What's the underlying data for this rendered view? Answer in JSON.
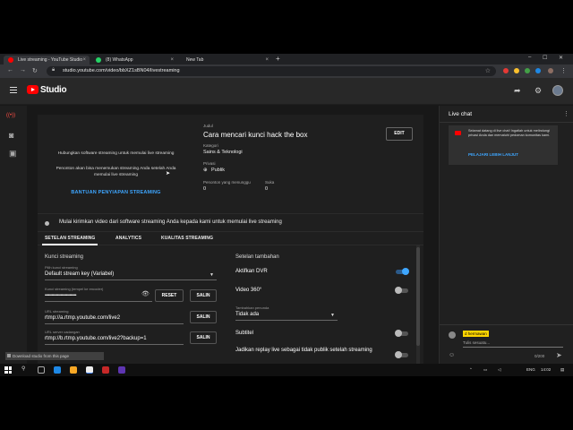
{
  "browser": {
    "tabs": [
      {
        "label": "Live streaming - YouTube Studio",
        "close": "×",
        "color": "#ff0000"
      },
      {
        "label": "(8) WhatsApp",
        "close": "×",
        "color": "#25d366"
      },
      {
        "label": "New Tab",
        "close": "×",
        "color": "#888888"
      }
    ],
    "new_tab": "+",
    "window_controls": [
      "–",
      "☐",
      "✕"
    ],
    "url": "studio.youtube.com/video/bbXZ1sBN04/livestreaming",
    "nav": [
      "←",
      "→",
      "↻"
    ]
  },
  "header": {
    "logo_text": "Studio",
    "icons": [
      "share-icon",
      "gear-icon",
      "avatar"
    ]
  },
  "rail": {
    "icons": [
      {
        "name": "live-icon",
        "glyph": "((•))",
        "active": true
      },
      {
        "name": "camera-icon",
        "glyph": "◙",
        "active": false
      },
      {
        "name": "calendar-icon",
        "glyph": "▣",
        "active": false
      }
    ]
  },
  "preview": {
    "line1": "Hubungkan software streaming untuk memulai live streaming",
    "line2": "Penonton akan bisa menemukan streaming Anda setelah Anda memulai live streaming",
    "help_link": "BANTUAN PENYIAPAN STREAMING"
  },
  "details": {
    "title_label": "Judul",
    "title": "Cara mencari kunci hack the box",
    "edit": "EDIT",
    "category_label": "Kategori",
    "category": "Sains & Teknologi",
    "privacy_label": "Privasi",
    "privacy": "Publik",
    "viewers_label": "Penonton yang menunggu",
    "viewers": "0",
    "likes_label": "Suka",
    "likes": "0"
  },
  "status": {
    "message": "Mulai kirimkan video dari software streaming Anda kepada kami untuk memulai live streaming"
  },
  "settings_tabs": [
    {
      "label": "SETELAN STREAMING",
      "active": true
    },
    {
      "label": "ANALYTICS",
      "active": false
    },
    {
      "label": "KUALITAS STREAMING",
      "active": false
    }
  ],
  "stream_key": {
    "section": "Kunci streaming",
    "select_label": "Pilih kunci streaming",
    "select_value": "Default stream key (Variabel)",
    "key_label": "Kunci streaming (tempel ke encoder)",
    "key_value": "••••••••••••••••••••••••••••",
    "reset": "RESET",
    "copy": "SALIN",
    "url_label": "URL streaming",
    "url_value": "rtmp://a.rtmp.youtube.com/live2",
    "backup_label": "URL server cadangan",
    "backup_value": "rtmp://b.rtmp.youtube.com/live2?backup=1"
  },
  "additional": {
    "section": "Setelan tambahan",
    "dvr": "Aktifkan DVR",
    "dvr_on": true,
    "v360": "Video 360°",
    "v360_on": false,
    "latency_label": "Tambahkan penunda",
    "latency_value": "Tidak ada",
    "subtitle": "Subtitel",
    "subtitle_on": false,
    "replay": "Jadikan replay live sebagai tidak publik setelah streaming"
  },
  "toast": "Download studio from this page",
  "chat": {
    "title": "Live chat",
    "welcome": "Selamat datang di live chat! Ingatlah untuk melindungi privasi Anda dan mematuhi pedoman komunitas kami.",
    "learn_more": "PELAJARI LEBIH LANJUT",
    "user": "d hermawan",
    "placeholder": "Tulis sesuatu...",
    "counter": "0/200"
  },
  "taskbar": {
    "lang": "ENG",
    "time": "14:02"
  }
}
